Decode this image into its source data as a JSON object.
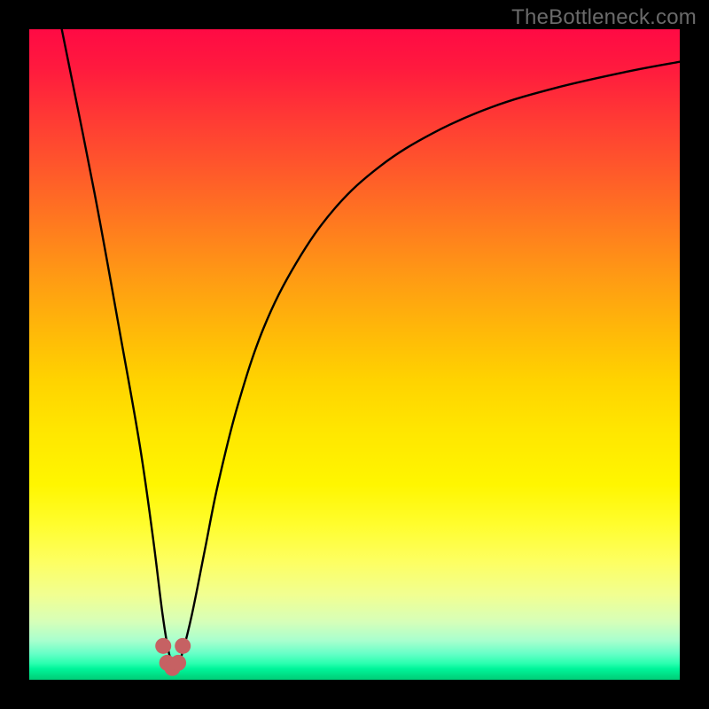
{
  "watermark": "TheBottleneck.com",
  "chart_data": {
    "type": "line",
    "title": "",
    "xlabel": "",
    "ylabel": "",
    "xlim": [
      0,
      100
    ],
    "ylim": [
      0,
      100
    ],
    "series": [
      {
        "name": "bottleneck-curve",
        "x": [
          5,
          10,
          14,
          17,
          19,
          20.5,
          21.5,
          22.5,
          23.5,
          25,
          27,
          29,
          32,
          36,
          41,
          47,
          54,
          62,
          71,
          81,
          92,
          100
        ],
        "values": [
          100,
          75,
          53,
          36,
          22,
          10,
          4,
          1.5,
          4,
          10,
          20,
          30,
          42,
          54,
          64,
          72.5,
          79,
          84,
          88,
          91,
          93.5,
          95
        ]
      }
    ],
    "markers": {
      "name": "highlight-points",
      "color": "#c66163",
      "x": [
        20.6,
        21.2,
        22.0,
        22.9,
        23.6
      ],
      "values": [
        5.2,
        2.6,
        1.8,
        2.6,
        5.2
      ]
    },
    "gradient_stops": [
      {
        "pos": 0,
        "color": "#ff0a44"
      },
      {
        "pos": 0.54,
        "color": "#ffd300"
      },
      {
        "pos": 0.82,
        "color": "#fdff63"
      },
      {
        "pos": 0.97,
        "color": "#2affaf"
      },
      {
        "pos": 1.0,
        "color": "#00cf79"
      }
    ]
  }
}
